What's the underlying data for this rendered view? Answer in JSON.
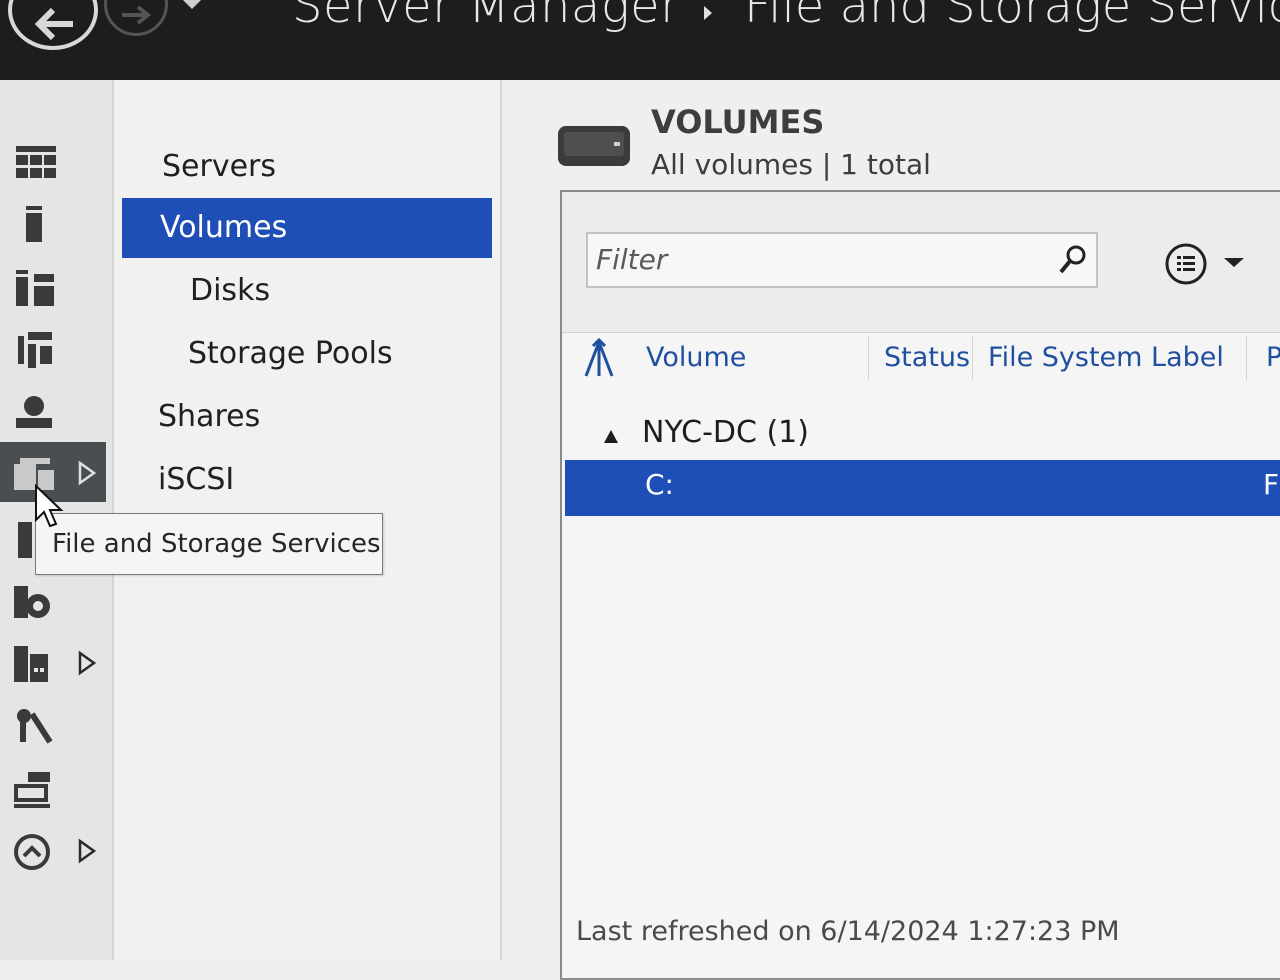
{
  "titlebar": {
    "app_title": "Server Manager",
    "page_title": "File and Storage Services"
  },
  "rail": {
    "items": [
      {
        "name": "dashboard-icon"
      },
      {
        "name": "local-server-icon"
      },
      {
        "name": "all-servers-icon"
      },
      {
        "name": "ad-ds-icon"
      },
      {
        "name": "dns-icon"
      },
      {
        "name": "file-storage-icon",
        "has_arrow": true,
        "active": true
      },
      {
        "name": "iis-icon"
      },
      {
        "name": "server-role-icon"
      },
      {
        "name": "remote-desktop-icon",
        "has_arrow": true
      },
      {
        "name": "tools-icon"
      },
      {
        "name": "print-services-icon"
      },
      {
        "name": "wsus-icon",
        "has_arrow": true
      }
    ]
  },
  "subnav": {
    "items": [
      {
        "label": "Servers"
      },
      {
        "label": "Volumes",
        "selected": true
      },
      {
        "label": "Disks"
      },
      {
        "label": "Storage Pools"
      },
      {
        "label": "Shares"
      },
      {
        "label": "iSCSI"
      }
    ]
  },
  "tooltip": "File and Storage Services",
  "main": {
    "title": "VOLUMES",
    "subtitle": "All volumes | 1 total",
    "filter_placeholder": "Filter",
    "columns": [
      "Volume",
      "Status",
      "File System Label",
      "P"
    ],
    "group": "NYC-DC (1)",
    "rows": [
      {
        "volume": "C:",
        "trailing": "F",
        "selected": true
      }
    ],
    "footer": "Last refreshed on 6/14/2024 1:27:23 PM"
  },
  "colors": {
    "selection": "#1f4fb6",
    "titlebar": "#1c1d1d",
    "header_link": "#1f4f9e"
  }
}
